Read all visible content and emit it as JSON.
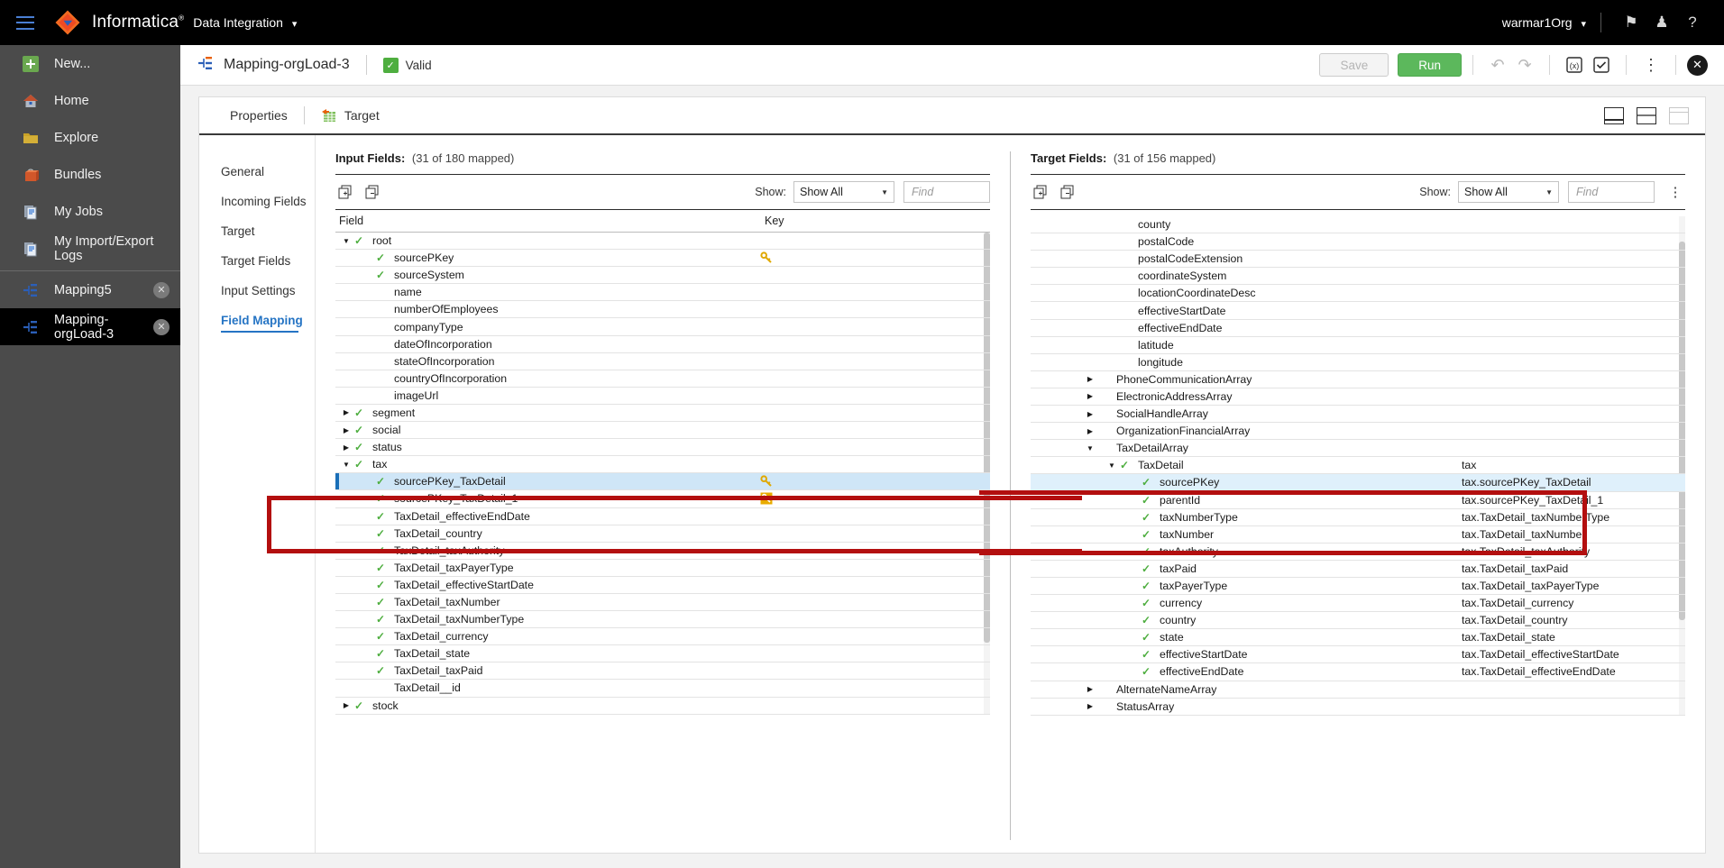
{
  "topbar": {
    "menu_icon": "hamburger-icon",
    "brand": "Informatica",
    "service": "Data Integration",
    "service_chevron": "chevron-down-icon",
    "org": "warmar1Org",
    "org_chevron": "chevron-down-icon",
    "flag_icon": "flag-icon",
    "user_icon": "user-icon",
    "help_icon": "help-icon"
  },
  "leftnav": {
    "items": [
      {
        "label": "New...",
        "icon": "plus-icon",
        "active": false,
        "closable": false
      },
      {
        "label": "Home",
        "icon": "home-icon",
        "active": false,
        "closable": false
      },
      {
        "label": "Explore",
        "icon": "folder-icon",
        "active": false,
        "closable": false
      },
      {
        "label": "Bundles",
        "icon": "bundle-icon",
        "active": false,
        "closable": false
      },
      {
        "label": "My Jobs",
        "icon": "jobs-icon",
        "active": false,
        "closable": false
      },
      {
        "label": "My Import/Export Logs",
        "icon": "logs-icon",
        "active": false,
        "closable": false
      }
    ],
    "open_docs": [
      {
        "label": "Mapping5",
        "icon": "mapping-icon",
        "active": false,
        "closable": true,
        "close_icon": "close-icon"
      },
      {
        "label": "Mapping-orgLoad-3",
        "icon": "mapping-icon",
        "active": true,
        "closable": true,
        "close_icon": "close-icon"
      }
    ]
  },
  "doc_header": {
    "icon": "mapping-icon",
    "title": "Mapping-orgLoad-3",
    "status": "Valid",
    "status_icon": "check-icon",
    "save_label": "Save",
    "run_label": "Run",
    "undo_icon": "undo-icon",
    "redo_icon": "redo-icon",
    "expression_icon": "expression-icon",
    "validate_icon": "validate-icon",
    "more_icon": "kebab-icon",
    "close_icon": "close-icon"
  },
  "tabs": [
    {
      "label": "Properties",
      "icon": null,
      "active": true
    },
    {
      "label": "Target",
      "icon": "target-table-icon",
      "active": false
    }
  ],
  "view_icons": [
    {
      "name": "view-single-icon"
    },
    {
      "name": "view-split-icon"
    },
    {
      "name": "view-collapsed-icon"
    }
  ],
  "subnav": {
    "items": [
      {
        "label": "General",
        "active": false
      },
      {
        "label": "Incoming Fields",
        "active": false
      },
      {
        "label": "Target",
        "active": false
      },
      {
        "label": "Target Fields",
        "active": false
      },
      {
        "label": "Input Settings",
        "active": false
      },
      {
        "label": "Field Mapping",
        "active": true
      }
    ]
  },
  "input_panel": {
    "title": "Input Fields:",
    "count": "(31 of 180 mapped)",
    "expand_icon": "expand-all-icon",
    "collapse_icon": "collapse-all-icon",
    "show_label": "Show:",
    "show_value": "Show All",
    "find_placeholder": "Find",
    "columns": {
      "field": "Field",
      "key": "Key"
    },
    "rows": [
      {
        "label": "root",
        "indent": 0,
        "tri": "down",
        "check": true,
        "key": null
      },
      {
        "label": "sourcePKey",
        "indent": 1,
        "tri": null,
        "check": true,
        "key": "key-gold-icon"
      },
      {
        "label": "sourceSystem",
        "indent": 1,
        "tri": null,
        "check": true,
        "key": null
      },
      {
        "label": "name",
        "indent": 1,
        "tri": null,
        "check": false,
        "key": null
      },
      {
        "label": "numberOfEmployees",
        "indent": 1,
        "tri": null,
        "check": false,
        "key": null
      },
      {
        "label": "companyType",
        "indent": 1,
        "tri": null,
        "check": false,
        "key": null
      },
      {
        "label": "dateOfIncorporation",
        "indent": 1,
        "tri": null,
        "check": false,
        "key": null
      },
      {
        "label": "stateOfIncorporation",
        "indent": 1,
        "tri": null,
        "check": false,
        "key": null
      },
      {
        "label": "countryOfIncorporation",
        "indent": 1,
        "tri": null,
        "check": false,
        "key": null
      },
      {
        "label": "imageUrl",
        "indent": 1,
        "tri": null,
        "check": false,
        "key": null
      },
      {
        "label": "segment",
        "indent": 0,
        "tri": "right",
        "check": true,
        "key": null
      },
      {
        "label": "social",
        "indent": 0,
        "tri": "right",
        "check": true,
        "key": null
      },
      {
        "label": "status",
        "indent": 0,
        "tri": "right",
        "check": true,
        "key": null
      },
      {
        "label": "tax",
        "indent": 0,
        "tri": "down",
        "check": true,
        "key": null
      },
      {
        "label": "sourcePKey_TaxDetail",
        "indent": 1,
        "tri": null,
        "check": true,
        "key": "key-gold-icon",
        "selected": true
      },
      {
        "label": "sourcePKey_TaxDetail_1",
        "indent": 1,
        "tri": null,
        "check": true,
        "key": "key-boxed-icon"
      },
      {
        "label": "TaxDetail_effectiveEndDate",
        "indent": 1,
        "tri": null,
        "check": true,
        "key": null
      },
      {
        "label": "TaxDetail_country",
        "indent": 1,
        "tri": null,
        "check": true,
        "key": null
      },
      {
        "label": "TaxDetail_taxAuthority",
        "indent": 1,
        "tri": null,
        "check": true,
        "key": null
      },
      {
        "label": "TaxDetail_taxPayerType",
        "indent": 1,
        "tri": null,
        "check": true,
        "key": null
      },
      {
        "label": "TaxDetail_effectiveStartDate",
        "indent": 1,
        "tri": null,
        "check": true,
        "key": null
      },
      {
        "label": "TaxDetail_taxNumber",
        "indent": 1,
        "tri": null,
        "check": true,
        "key": null
      },
      {
        "label": "TaxDetail_taxNumberType",
        "indent": 1,
        "tri": null,
        "check": true,
        "key": null
      },
      {
        "label": "TaxDetail_currency",
        "indent": 1,
        "tri": null,
        "check": true,
        "key": null
      },
      {
        "label": "TaxDetail_state",
        "indent": 1,
        "tri": null,
        "check": true,
        "key": null
      },
      {
        "label": "TaxDetail_taxPaid",
        "indent": 1,
        "tri": null,
        "check": true,
        "key": null
      },
      {
        "label": "TaxDetail__id",
        "indent": 1,
        "tri": null,
        "check": false,
        "key": null
      },
      {
        "label": "stock",
        "indent": 0,
        "tri": "right",
        "check": true,
        "key": null
      }
    ]
  },
  "target_panel": {
    "title": "Target Fields:",
    "count": "(31 of 156 mapped)",
    "expand_icon": "expand-all-icon",
    "collapse_icon": "collapse-all-icon",
    "show_label": "Show:",
    "show_value": "Show All",
    "find_placeholder": "Find",
    "more_icon": "kebab-icon",
    "rows": [
      {
        "label": "county",
        "indent": 2,
        "tri": null,
        "check": false,
        "mapped": ""
      },
      {
        "label": "postalCode",
        "indent": 2,
        "tri": null,
        "check": false,
        "mapped": ""
      },
      {
        "label": "postalCodeExtension",
        "indent": 2,
        "tri": null,
        "check": false,
        "mapped": ""
      },
      {
        "label": "coordinateSystem",
        "indent": 2,
        "tri": null,
        "check": false,
        "mapped": ""
      },
      {
        "label": "locationCoordinateDesc",
        "indent": 2,
        "tri": null,
        "check": false,
        "mapped": ""
      },
      {
        "label": "effectiveStartDate",
        "indent": 2,
        "tri": null,
        "check": false,
        "mapped": ""
      },
      {
        "label": "effectiveEndDate",
        "indent": 2,
        "tri": null,
        "check": false,
        "mapped": ""
      },
      {
        "label": "latitude",
        "indent": 2,
        "tri": null,
        "check": false,
        "mapped": ""
      },
      {
        "label": "longitude",
        "indent": 2,
        "tri": null,
        "check": false,
        "mapped": ""
      },
      {
        "label": "PhoneCommunicationArray",
        "indent": 1,
        "tri": "right",
        "check": false,
        "mapped": ""
      },
      {
        "label": "ElectronicAddressArray",
        "indent": 1,
        "tri": "right",
        "check": false,
        "mapped": ""
      },
      {
        "label": "SocialHandleArray",
        "indent": 1,
        "tri": "right",
        "check": false,
        "mapped": ""
      },
      {
        "label": "OrganizationFinancialArray",
        "indent": 1,
        "tri": "right",
        "check": false,
        "mapped": ""
      },
      {
        "label": "TaxDetailArray",
        "indent": 1,
        "tri": "down",
        "check": false,
        "mapped": ""
      },
      {
        "label": "TaxDetail",
        "indent": 2,
        "tri": "down",
        "check": true,
        "mapped": "tax"
      },
      {
        "label": "sourcePKey",
        "indent": 3,
        "tri": null,
        "check": true,
        "mapped": "tax.sourcePKey_TaxDetail",
        "selected": true
      },
      {
        "label": "parentId",
        "indent": 3,
        "tri": null,
        "check": true,
        "mapped": "tax.sourcePKey_TaxDetail_1"
      },
      {
        "label": "taxNumberType",
        "indent": 3,
        "tri": null,
        "check": true,
        "mapped": "tax.TaxDetail_taxNumberType"
      },
      {
        "label": "taxNumber",
        "indent": 3,
        "tri": null,
        "check": true,
        "mapped": "tax.TaxDetail_taxNumber"
      },
      {
        "label": "taxAuthority",
        "indent": 3,
        "tri": null,
        "check": true,
        "mapped": "tax.TaxDetail_taxAuthority"
      },
      {
        "label": "taxPaid",
        "indent": 3,
        "tri": null,
        "check": true,
        "mapped": "tax.TaxDetail_taxPaid"
      },
      {
        "label": "taxPayerType",
        "indent": 3,
        "tri": null,
        "check": true,
        "mapped": "tax.TaxDetail_taxPayerType"
      },
      {
        "label": "currency",
        "indent": 3,
        "tri": null,
        "check": true,
        "mapped": "tax.TaxDetail_currency"
      },
      {
        "label": "country",
        "indent": 3,
        "tri": null,
        "check": true,
        "mapped": "tax.TaxDetail_country"
      },
      {
        "label": "state",
        "indent": 3,
        "tri": null,
        "check": true,
        "mapped": "tax.TaxDetail_state"
      },
      {
        "label": "effectiveStartDate",
        "indent": 3,
        "tri": null,
        "check": true,
        "mapped": "tax.TaxDetail_effectiveStartDate"
      },
      {
        "label": "effectiveEndDate",
        "indent": 3,
        "tri": null,
        "check": true,
        "mapped": "tax.TaxDetail_effectiveEndDate"
      },
      {
        "label": "AlternateNameArray",
        "indent": 1,
        "tri": "right",
        "check": false,
        "mapped": ""
      },
      {
        "label": "StatusArray",
        "indent": 1,
        "tri": "right",
        "check": false,
        "mapped": ""
      }
    ]
  },
  "annotation": {
    "color": "#b30f0f",
    "label": "highlight-box"
  }
}
